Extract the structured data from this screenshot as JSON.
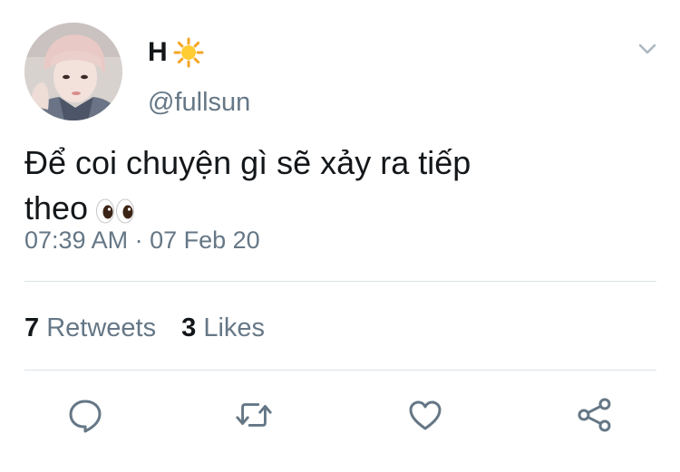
{
  "author": {
    "name": "H",
    "name_emoji": "sun-emoji-icon",
    "handle": "@fullsun"
  },
  "tweet": {
    "text_line1": "Để coi chuyện gì sẽ xảy ra tiếp",
    "text_line2": "theo",
    "text_emoji": "eyes-emoji-icon",
    "timestamp": "07:39 AM · 07 Feb 20"
  },
  "stats": {
    "retweets_count": "7",
    "retweets_label": "Retweets",
    "likes_count": "3",
    "likes_label": "Likes"
  },
  "actions": [
    "reply-icon",
    "retweet-icon",
    "like-icon",
    "share-icon"
  ],
  "colors": {
    "primary_text": "#14171a",
    "secondary_text": "#657786",
    "divider": "#dde3e8",
    "icon": "#657786"
  }
}
